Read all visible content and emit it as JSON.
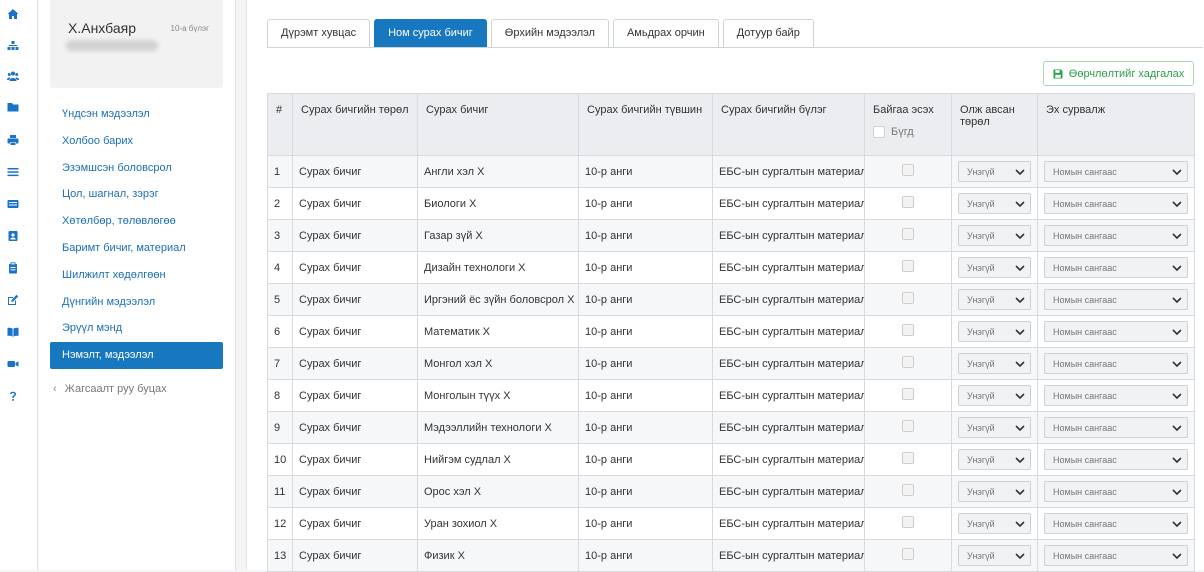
{
  "profile": {
    "name": "Х.Анхбаяр",
    "grade": "10-а бүлэг"
  },
  "sidebar": {
    "items": [
      {
        "label": "Үндсэн мэдээлэл"
      },
      {
        "label": "Холбоо барих"
      },
      {
        "label": "Эзэмшсэн боловсрол"
      },
      {
        "label": "Цол, шагнал, зэрэг"
      },
      {
        "label": "Хөтөлбөр, төлөвлөгөө"
      },
      {
        "label": "Баримт бичиг, материал"
      },
      {
        "label": "Шилжилт хөдөлгөөн"
      },
      {
        "label": "Дүнгийн мэдээлэл"
      },
      {
        "label": "Эрүүл мэнд"
      },
      {
        "label": "Нэмэлт, мэдээлэл",
        "active": true
      }
    ],
    "back_label": "Жагсаалт руу буцах"
  },
  "icons": [
    "home-icon",
    "sitemap-icon",
    "users-icon",
    "folder-icon",
    "print-icon",
    "list-icon",
    "id-card-icon",
    "contact-card-icon",
    "clipboard-icon",
    "edit-icon",
    "book-icon",
    "video-icon",
    "question-icon"
  ],
  "tabs": [
    {
      "label": "Дүрэмт хувцас"
    },
    {
      "label": "Ном сурах бичиг",
      "active": true
    },
    {
      "label": "Өрхийн мэдээлэл"
    },
    {
      "label": "Амьдрах орчин"
    },
    {
      "label": "Дотуур байр"
    }
  ],
  "save_button": {
    "label": "Өөрчлөлтийг хадгалах"
  },
  "table": {
    "headers": {
      "num": "#",
      "type": "Сурах бичгийн төрөл",
      "book": "Сурах бичиг",
      "level": "Сурах бичгийн түвшин",
      "group": "Сурах бичгийн бүлэг",
      "exists": "Байгаа эсэх",
      "all": "Бүгд",
      "received": "Олж авсан төрөл",
      "source": "Эх сурвалж"
    },
    "rows": [
      {
        "num": "1",
        "type": "Сурах бичиг",
        "book": "Англи хэл X",
        "level": "10-р анги",
        "group": "ЕБС-ын сургалтын материал",
        "received": "Унэгүй",
        "source": "Номын сангаас"
      },
      {
        "num": "2",
        "type": "Сурах бичиг",
        "book": "Биологи X",
        "level": "10-р анги",
        "group": "ЕБС-ын сургалтын материал",
        "received": "Унэгүй",
        "source": "Номын сангаас"
      },
      {
        "num": "3",
        "type": "Сурах бичиг",
        "book": "Газар зүй X",
        "level": "10-р анги",
        "group": "ЕБС-ын сургалтын материал",
        "received": "Унэгүй",
        "source": "Номын сангаас"
      },
      {
        "num": "4",
        "type": "Сурах бичиг",
        "book": "Дизайн технологи X",
        "level": "10-р анги",
        "group": "ЕБС-ын сургалтын материал",
        "received": "Унэгүй",
        "source": "Номын сангаас"
      },
      {
        "num": "5",
        "type": "Сурах бичиг",
        "book": "Иргэний ёс зүйн боловсрол X",
        "level": "10-р анги",
        "group": "ЕБС-ын сургалтын материал",
        "received": "Унэгүй",
        "source": "Номын сангаас"
      },
      {
        "num": "6",
        "type": "Сурах бичиг",
        "book": "Математик X",
        "level": "10-р анги",
        "group": "ЕБС-ын сургалтын материал",
        "received": "Унэгүй",
        "source": "Номын сангаас"
      },
      {
        "num": "7",
        "type": "Сурах бичиг",
        "book": "Монгол хэл X",
        "level": "10-р анги",
        "group": "ЕБС-ын сургалтын материал",
        "received": "Унэгүй",
        "source": "Номын сангаас"
      },
      {
        "num": "8",
        "type": "Сурах бичиг",
        "book": "Монголын түүх X",
        "level": "10-р анги",
        "group": "ЕБС-ын сургалтын материал",
        "received": "Унэгүй",
        "source": "Номын сангаас"
      },
      {
        "num": "9",
        "type": "Сурах бичиг",
        "book": "Мэдээллийн технологи X",
        "level": "10-р анги",
        "group": "ЕБС-ын сургалтын материал",
        "received": "Унэгүй",
        "source": "Номын сангаас"
      },
      {
        "num": "10",
        "type": "Сурах бичиг",
        "book": "Нийгэм судлал X",
        "level": "10-р анги",
        "group": "ЕБС-ын сургалтын материал",
        "received": "Унэгүй",
        "source": "Номын сангаас"
      },
      {
        "num": "11",
        "type": "Сурах бичиг",
        "book": "Орос хэл X",
        "level": "10-р анги",
        "group": "ЕБС-ын сургалтын материал",
        "received": "Унэгүй",
        "source": "Номын сангаас"
      },
      {
        "num": "12",
        "type": "Сурах бичиг",
        "book": "Уран зохиол X",
        "level": "10-р анги",
        "group": "ЕБС-ын сургалтын материал",
        "received": "Унэгүй",
        "source": "Номын сангаас"
      },
      {
        "num": "13",
        "type": "Сурах бичиг",
        "book": "Физик X",
        "level": "10-р анги",
        "group": "ЕБС-ын сургалтын материал",
        "received": "Унэгүй",
        "source": "Номын сангаас"
      }
    ]
  },
  "colors": {
    "accent": "#1778bf",
    "success": "#2aa14a",
    "link": "#1a6fb5"
  }
}
